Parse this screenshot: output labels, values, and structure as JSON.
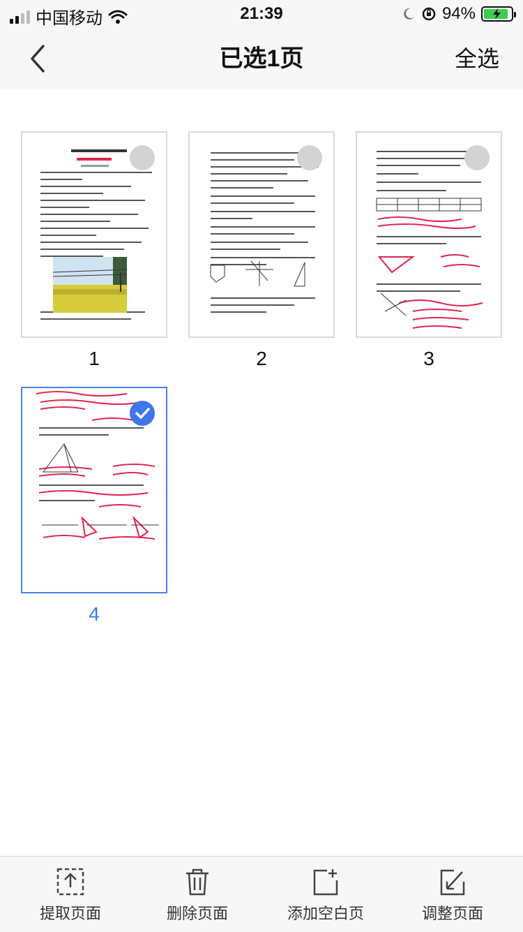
{
  "status_bar": {
    "carrier": "中国移动",
    "time": "21:39",
    "battery": "94%"
  },
  "nav": {
    "title": "已选1页",
    "select_all": "全选"
  },
  "pages": [
    {
      "number": "1",
      "selected": false
    },
    {
      "number": "2",
      "selected": false
    },
    {
      "number": "3",
      "selected": false
    },
    {
      "number": "4",
      "selected": true
    }
  ],
  "toolbar": {
    "extract": "提取页面",
    "delete": "删除页面",
    "add_blank": "添加空白页",
    "adjust": "调整页面"
  },
  "colors": {
    "accent": "#3d77ea",
    "annotation_red": "#e4224c"
  },
  "icons": [
    "back-chevron-icon",
    "wifi-icon",
    "moon-icon",
    "rotation-lock-icon",
    "battery-charging-icon",
    "extract-icon",
    "trash-icon",
    "add-page-icon",
    "adjust-icon",
    "checkmark-icon"
  ]
}
